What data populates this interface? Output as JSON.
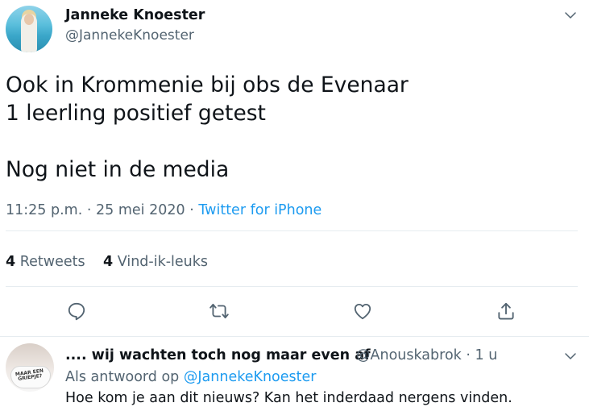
{
  "tweet": {
    "author_name": "Janneke Knoester",
    "author_handle": "@JannekeKnoester",
    "text_lines": [
      "Ook in Krommenie bij obs de Evenaar",
      "1 leerling positief getest",
      "",
      "Nog niet in de media"
    ],
    "time": "11:25 p.m.",
    "date": "25 mei 2020",
    "separator": "·",
    "source": "Twitter for iPhone",
    "retweets_count": "4",
    "retweets_label": "Retweets",
    "likes_count": "4",
    "likes_label": "Vind-ik-leuks",
    "icons": [
      "chevron-down-icon",
      "reply-icon",
      "retweet-icon",
      "like-icon",
      "share-icon"
    ]
  },
  "reply": {
    "author_name": ".... wij wachten toch nog maar even af",
    "author_handle": "@Anouskabrok",
    "separator": "·",
    "age": "1 u",
    "replying_to_label": "Als antwoord op",
    "replying_to_handle": "@JannekeKnoester",
    "text": "Hoe kom je aan dit nieuws? Kan het inderdaad nergens vinden.",
    "avatar_mask_text": "MAAR EEN GRIEPJE?"
  },
  "colors": {
    "accent": "#1d9bf0",
    "text": "#0f1419",
    "muted": "#536471",
    "divider": "#e6ecf0"
  }
}
